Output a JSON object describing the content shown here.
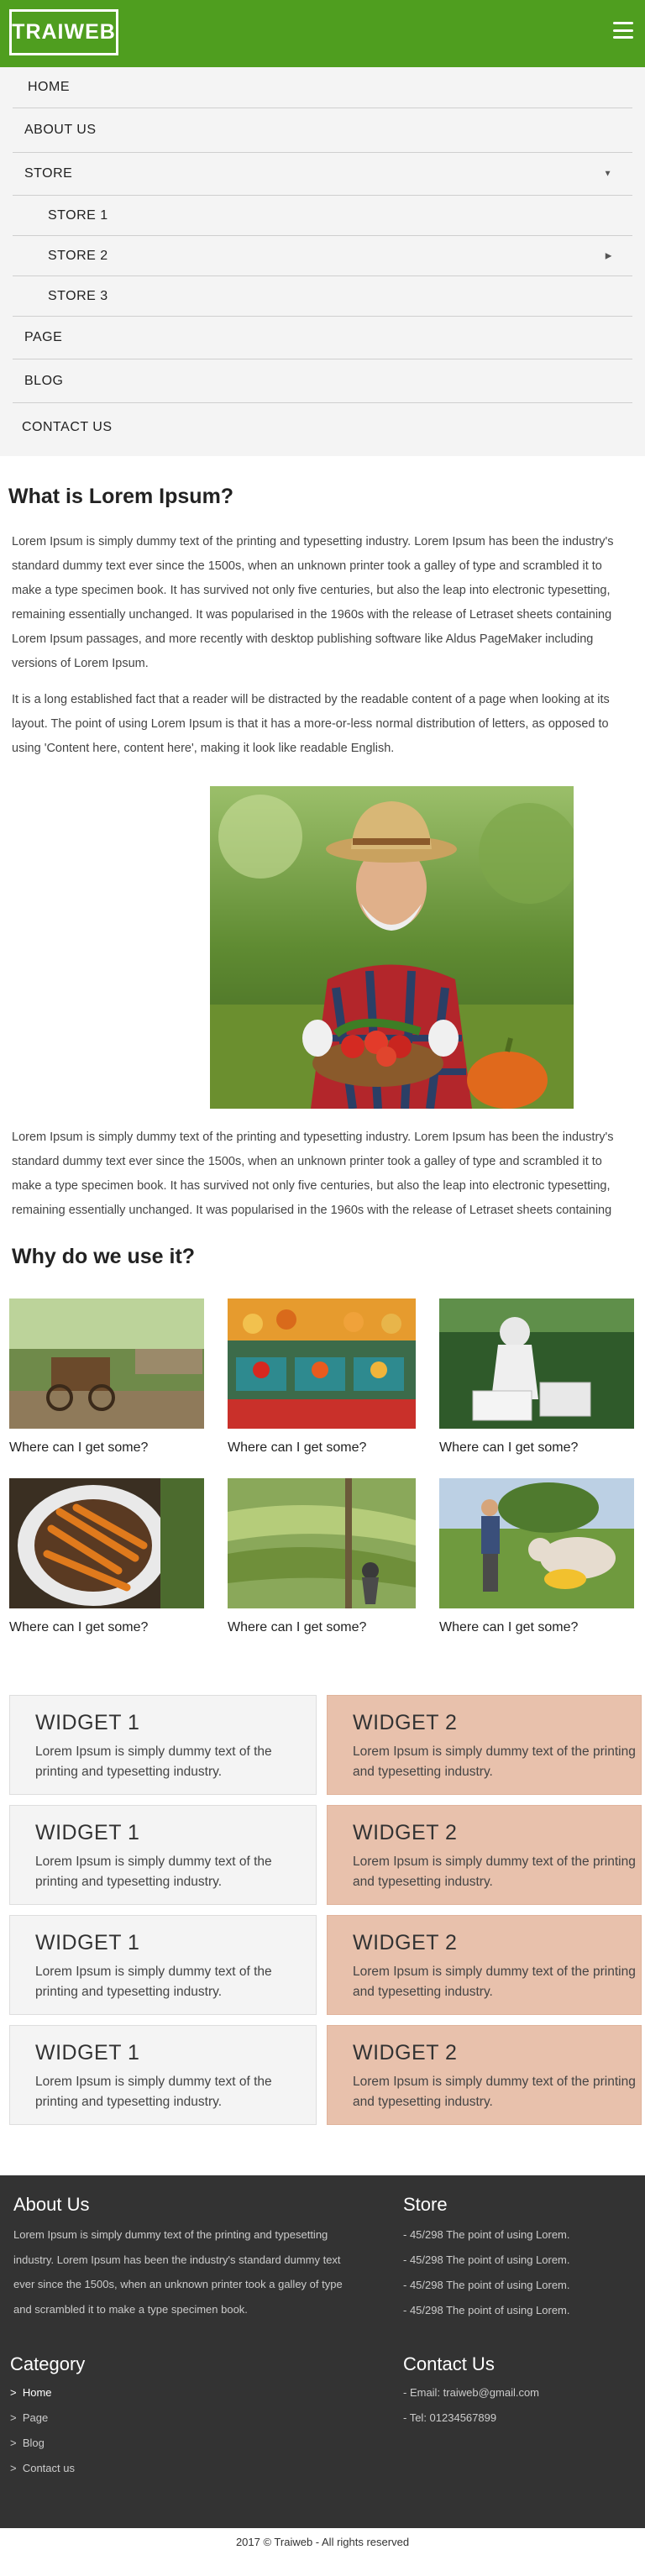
{
  "header": {
    "logo": "TRAIWEB"
  },
  "menu": {
    "home": "HOME",
    "about": "ABOUT US",
    "store": "STORE",
    "store1": "STORE 1",
    "store2": "STORE 2",
    "store3": "STORE 3",
    "page": "PAGE",
    "blog": "BLOG",
    "contact": "CONTACT US"
  },
  "article": {
    "title": "What is Lorem Ipsum?",
    "para1": "Lorem Ipsum is simply dummy text of the printing and typesetting industry. Lorem Ipsum has been the industry's standard dummy text ever since the 1500s, when an unknown printer took a galley of type and scrambled it to make a type specimen book. It has survived not only five centuries, but also the leap into electronic typesetting, remaining essentially unchanged. It was popularised in the 1960s with the release of Letraset sheets containing Lorem Ipsum passages, and more recently with desktop publishing software like Aldus PageMaker including versions of Lorem Ipsum.",
    "para2": "It is a long established fact that a reader will be distracted by the readable content of a page when looking at its layout. The point of using Lorem Ipsum is that it has a more-or-less normal distribution of letters, as opposed to using 'Content here, content here', making it look like readable English.",
    "para3": "Lorem Ipsum is simply dummy text of the printing and typesetting industry. Lorem Ipsum has been the industry's standard dummy text ever since the 1500s, when an unknown printer took a galley of type and scrambled it to make a type specimen book. It has survived not only five centuries, but also the leap into electronic typesetting, remaining essentially unchanged. It was popularised in the 1960s with the release of Letraset sheets containing"
  },
  "why": {
    "title": "Why do we use it?",
    "cards": [
      {
        "caption": "Where can I get some?"
      },
      {
        "caption": "Where can I get some?"
      },
      {
        "caption": "Where can I get some?"
      },
      {
        "caption": "Where can I get some?"
      },
      {
        "caption": "Where can I get some?"
      },
      {
        "caption": "Where can I get some?"
      }
    ]
  },
  "widgets": {
    "w1_title": "WIDGET 1",
    "w2_title": "WIDGET 2",
    "text": "Lorem Ipsum is simply dummy text of the printing and typesetting industry."
  },
  "footer": {
    "about_title": "About Us",
    "about_text": "Lorem Ipsum is simply dummy text of the printing and typesetting industry. Lorem Ipsum has been the industry's standard dummy text ever since the 1500s, when an unknown printer took a galley of type and scrambled it to make a type specimen book.",
    "store_title": "Store",
    "store_items": [
      "- 45/298 The point of using Lorem.",
      "- 45/298 The point of using Lorem.",
      "- 45/298 The point of using Lorem.",
      "- 45/298 The point of using Lorem."
    ],
    "category_title": "Category",
    "categories": [
      "Home",
      "Page",
      "Blog",
      "Contact us"
    ],
    "contact_title": "Contact Us",
    "email": "- Email: traiweb@gmail.com",
    "tel": "- Tel: 01234567899"
  },
  "copyright": "2017 © Traiweb - All rights reserved",
  "colors": {
    "header": "#4f9e1f",
    "widget2": "#e8c1ac",
    "footer": "#333333"
  }
}
